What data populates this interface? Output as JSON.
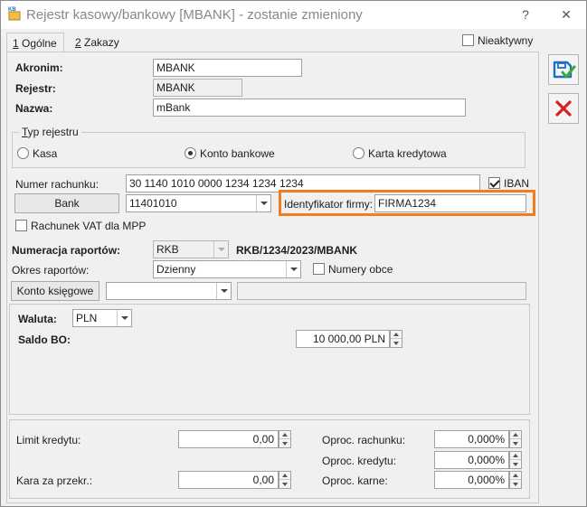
{
  "window": {
    "title": "Rejestr kasowy/bankowy [MBANK] - zostanie zmieniony",
    "icon_text": "KB",
    "help": "?",
    "close": "✕"
  },
  "tabs": [
    {
      "key": "1",
      "label": " Ogólne"
    },
    {
      "key": "2",
      "label": " Zakazy"
    }
  ],
  "inactive": {
    "label": "Nieaktywny",
    "checked": false
  },
  "fields": {
    "akronim_label": "Akronim:",
    "akronim_value": "MBANK",
    "rejestr_label": "Rejestr:",
    "rejestr_value": "MBANK",
    "nazwa_label": "Nazwa:",
    "nazwa_value": "mBank"
  },
  "type_group": {
    "legend_key": "T",
    "legend_rest": "yp rejestru",
    "options": [
      "Kasa",
      "Konto bankowe",
      "Karta kredytowa"
    ],
    "selected": "Konto bankowe"
  },
  "bank": {
    "account_label": "Numer rachunku:",
    "account_value": "30 1140 1010 0000 1234 1234 1234",
    "iban_label": "IBAN",
    "iban_checked": true,
    "bank_button": "Bank",
    "bank_value": "11401010",
    "company_id_label": "Identyfikator firmy:",
    "company_id_value": "FIRMA1234",
    "vat_label": "Rachunek VAT dla MPP",
    "vat_checked": false
  },
  "numbering": {
    "label": "Numeracja raportów:",
    "scheme_value": "RKB",
    "pattern": "RKB/1234/2023/MBANK",
    "period_label": "Okres raportów:",
    "period_value": "Dzienny",
    "shared_label": "Numery obce",
    "shared_checked": false,
    "account_button": "Konto księgowe",
    "account_value": "",
    "account_desc": ""
  },
  "currency": {
    "waluta_label": "Waluta:",
    "waluta_value": "PLN",
    "saldo_label": "Saldo BO:",
    "saldo_value": "10 000,00 PLN"
  },
  "limits": {
    "limit_label": "Limit kredytu:",
    "limit_value": "0,00",
    "penalty_label": "Kara za przekr.:",
    "penalty_value": "0,00",
    "acc_interest_label": "Oproc. rachunku:",
    "acc_interest_value": "0,000%",
    "credit_interest_label": "Oproc. kredytu:",
    "credit_interest_value": "0,000%",
    "penalty_interest_label": "Oproc. karne:",
    "penalty_interest_value": "0,000%"
  },
  "colors": {
    "highlight": "#f07d1e",
    "save_icon": "#1f6fc0",
    "cancel_icon": "#d42020",
    "check_green": "#3aa83a"
  }
}
